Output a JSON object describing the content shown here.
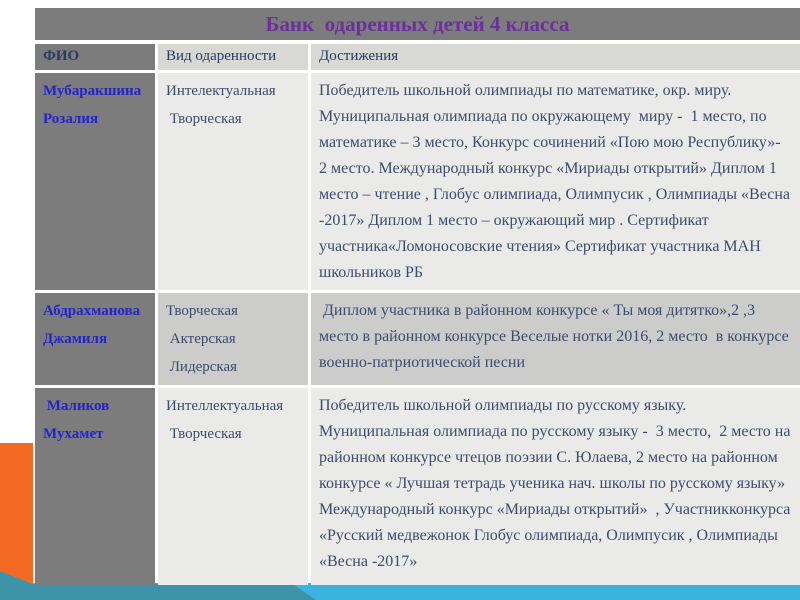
{
  "slide": {
    "title": "Банк  одаренных детей 4 класса",
    "table": {
      "headers": [
        "ФИО",
        "Вид одаренности",
        "Достижения"
      ],
      "rows": [
        {
          "name": "Мубаракшина\nРозалия",
          "giftedness": "Интелектуальная\n Творческая",
          "achievements": "Победитель школьной олимпиады по математике, окр. миру. Муниципальная олимпиада по окружающему  миру -  1 место, по математике – 3 место, Конкурс сочинений «Пою мою Республику»- 2 место. Международный конкурс «Мириады открытий» Диплом 1 место – чтение , Глобус олимпиада, Олимпусик , Олимпиады «Весна -2017» Диплом 1 место – окружающий мир . Сертификат  участника«Ломоносовские чтения» Сертификат участника МАН школьников РБ"
        },
        {
          "name": "Абдрахманова\nДжамиля",
          "giftedness": "Творческая\n Актерская\n Лидерская",
          "achievements": " Диплом участника в районном конкурсе « Ты моя дитятко»,2 ,3 место в районном конкурсе Веселые нотки 2016, 2 место  в конкурсе  военно-патриотической песни"
        },
        {
          "name": " Маликов\nМухамет",
          "giftedness": "Интеллектуальная\n Творческая",
          "achievements": "Победитель школьной олимпиады по русскому языку. Муниципальная олимпиада по русскому языку -  3 место,  2 место на районном конкурсе чтецов поэзии С. Юлаева, 2 место на районном конкурсе « Лучшая тетрадь ученика нач. школы по русскому языку» Международный конкурс «Мириады открытий»  , Участникконкурса «Русский медвежонок Глобус олимпиада, Олимпусик , Олимпиады «Весна -2017»"
        }
      ]
    },
    "colors": {
      "title_text": "#6d2f9c",
      "header_dark_bg": "#7c7c7c",
      "header_light_bg": "#d8d8d5",
      "row_light_bg": "#eaeae8",
      "row_mid_bg": "#ccccca",
      "name_text": "#2424cc",
      "body_text": "#3e4b6f",
      "accent_orange": "#f26a21",
      "accent_teal_dark": "#3d94a9",
      "accent_blue_light": "#3ab4de"
    }
  }
}
